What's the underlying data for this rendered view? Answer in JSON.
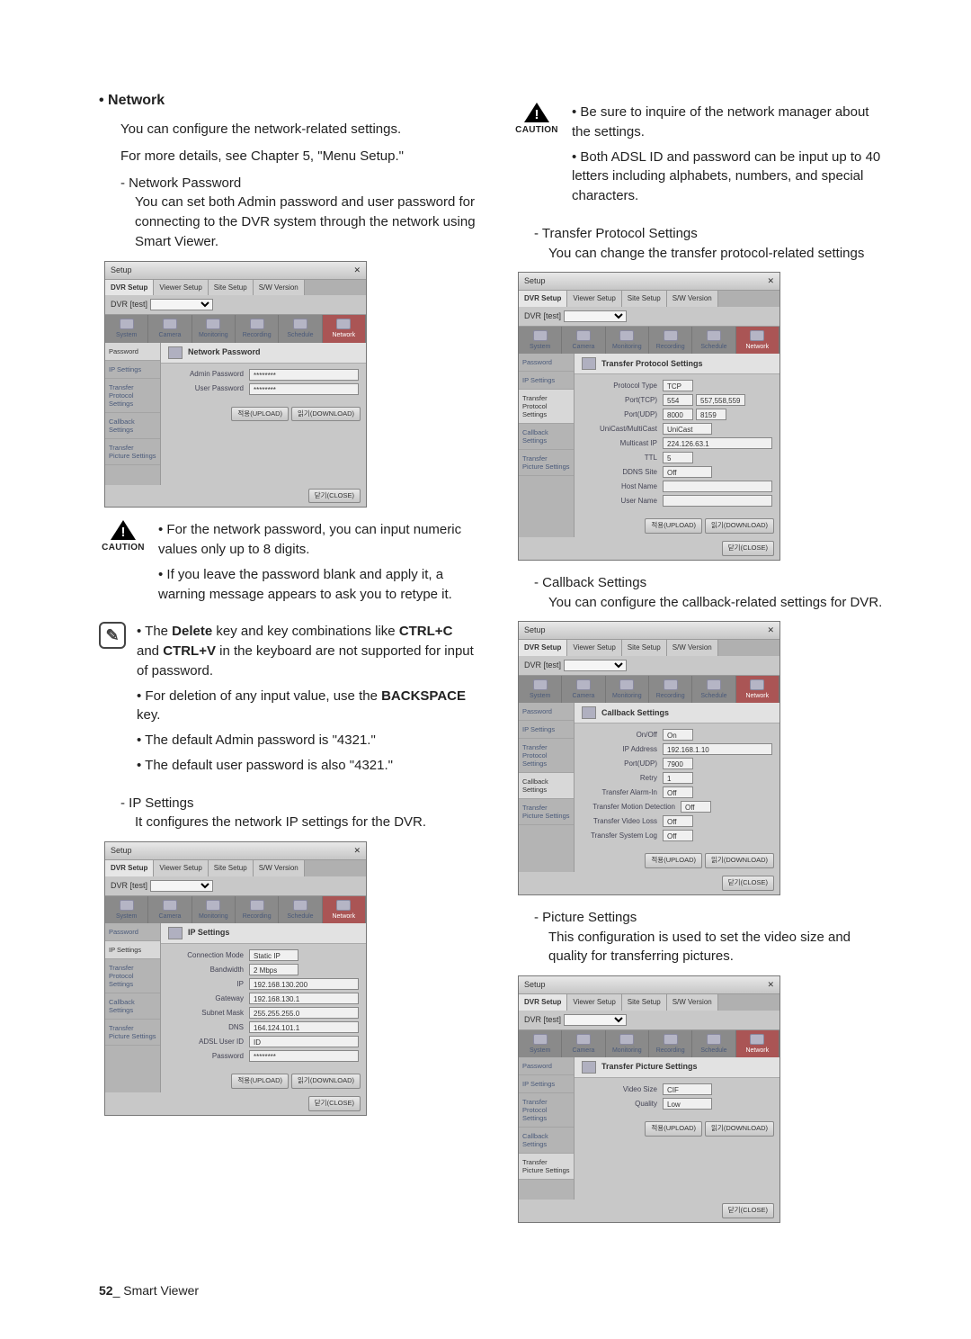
{
  "leftCol": {
    "networkHead": "Network",
    "networkIntro1": "You can configure the network-related settings.",
    "networkIntro2": "For more details, see Chapter 5, \"Menu Setup.\"",
    "netPassHead": "Network Password",
    "netPassBody": "You can set both Admin password and user password for connecting to the DVR system through the network using Smart Viewer.",
    "caution1": {
      "label": "CAUTION",
      "li1": "For the network password, you can input numeric values only up to 8 digits.",
      "li2": "If you leave the password blank and apply it, a warning message appears to ask you to retype it."
    },
    "note1": {
      "li1a": "The ",
      "li1b": "Delete",
      "li1c": " key and key combinations like ",
      "li1d": "CTRL+C",
      "li1e": " and ",
      "li1f": "CTRL+V",
      "li1g": " in the keyboard are not supported for input of password.",
      "li2a": "For deletion of any input value, use the ",
      "li2b": "BACKSPACE",
      "li2c": " key.",
      "li3": "The default Admin password is \"4321.\"",
      "li4": "The default user password is also \"4321.\""
    },
    "ipHead": "IP Settings",
    "ipBody": "It configures the network IP settings for the DVR."
  },
  "rightCol": {
    "caution2": {
      "label": "CAUTION",
      "li1": "Be sure to inquire of the network manager about the settings.",
      "li2": "Both ADSL ID and password can be input up to 40 letters including alphabets, numbers, and special characters."
    },
    "tpHead": "Transfer Protocol Settings",
    "tpBody": "You can change the transfer protocol-related settings",
    "cbHead": "Callback Settings",
    "cbBody": "You can configure the callback-related settings for DVR.",
    "psHead": "Picture Settings",
    "psBody": "This configuration is used to set the video size and quality for transferring pictures."
  },
  "shot": {
    "setup": "Setup",
    "tabs": {
      "dvr": "DVR Setup",
      "viewer": "Viewer Setup",
      "site": "Site Setup",
      "sw": "S/W Version"
    },
    "dvrLabel": "DVR [test]",
    "cats": {
      "system": "System",
      "camera": "Camera",
      "monitoring": "Monitoring",
      "recording": "Recording",
      "schedule": "Schedule",
      "network": "Network"
    },
    "side": {
      "pwd": "Password",
      "ip": "IP Settings",
      "tp": "Transfer Protocol Settings",
      "cb": "Callback Settings",
      "pic": "Transfer Picture Settings"
    },
    "btns": {
      "upload": "적용(UPLOAD)",
      "download": "읽기(DOWNLOAD)",
      "close": "닫기(CLOSE)"
    },
    "netpass": {
      "title": "Network Password",
      "admin": "Admin Password",
      "user": "User Password",
      "mask": "********"
    },
    "ip": {
      "title": "IP Settings",
      "connMode": "Connection Mode",
      "connModeVal": "Static IP",
      "bandwidth": "Bandwidth",
      "bandwidthVal": "2 Mbps",
      "ipLbl": "IP",
      "ipVal": "192.168.130.200",
      "gateway": "Gateway",
      "gatewayVal": "192.168.130.1",
      "subnet": "Subnet Mask",
      "subnetVal": "255.255.255.0",
      "dns": "DNS",
      "dnsVal": "164.124.101.1",
      "adsl": "ADSL User ID",
      "adslVal": "ID",
      "pwd": "Password",
      "pwdVal": "********"
    },
    "tp": {
      "title": "Transfer Protocol Settings",
      "ptype": "Protocol Type",
      "ptypeVal": "TCP",
      "portTcp": "Port(TCP)",
      "portTcpVal": "554",
      "portTcpVal2": "557,558,559",
      "portUdp": "Port(UDP)",
      "portUdpVal": "8000",
      "portUdpVal2": "8159",
      "unicast": "UniCast/MultiCast",
      "unicastVal": "UniCast",
      "mcip": "Multicast IP",
      "mcipVal": "224.126.63.1",
      "ttl": "TTL",
      "ttlVal": "5",
      "ddns": "DDNS Site",
      "ddnsVal": "Off",
      "host": "Host Name",
      "user": "User Name"
    },
    "cb": {
      "title": "Callback Settings",
      "onoff": "On/Off",
      "onoffVal": "On",
      "ipaddr": "IP Address",
      "ipaddrVal": "192.168.1.10",
      "port": "Port(UDP)",
      "portVal": "7900",
      "retry": "Retry",
      "retryVal": "1",
      "tai": "Transfer Alarm-In",
      "taiVal": "Off",
      "tmd": "Transfer Motion Detection",
      "tmdVal": "Off",
      "tvl": "Transfer Video Loss",
      "tvlVal": "Off",
      "tsl": "Transfer System Log",
      "tslVal": "Off"
    },
    "pic": {
      "title": "Transfer Picture Settings",
      "vsize": "Video Size",
      "vsizeVal": "CIF",
      "quality": "Quality",
      "qualityVal": "Low"
    }
  },
  "footer": {
    "page": "52",
    "title": "_ Smart Viewer"
  }
}
